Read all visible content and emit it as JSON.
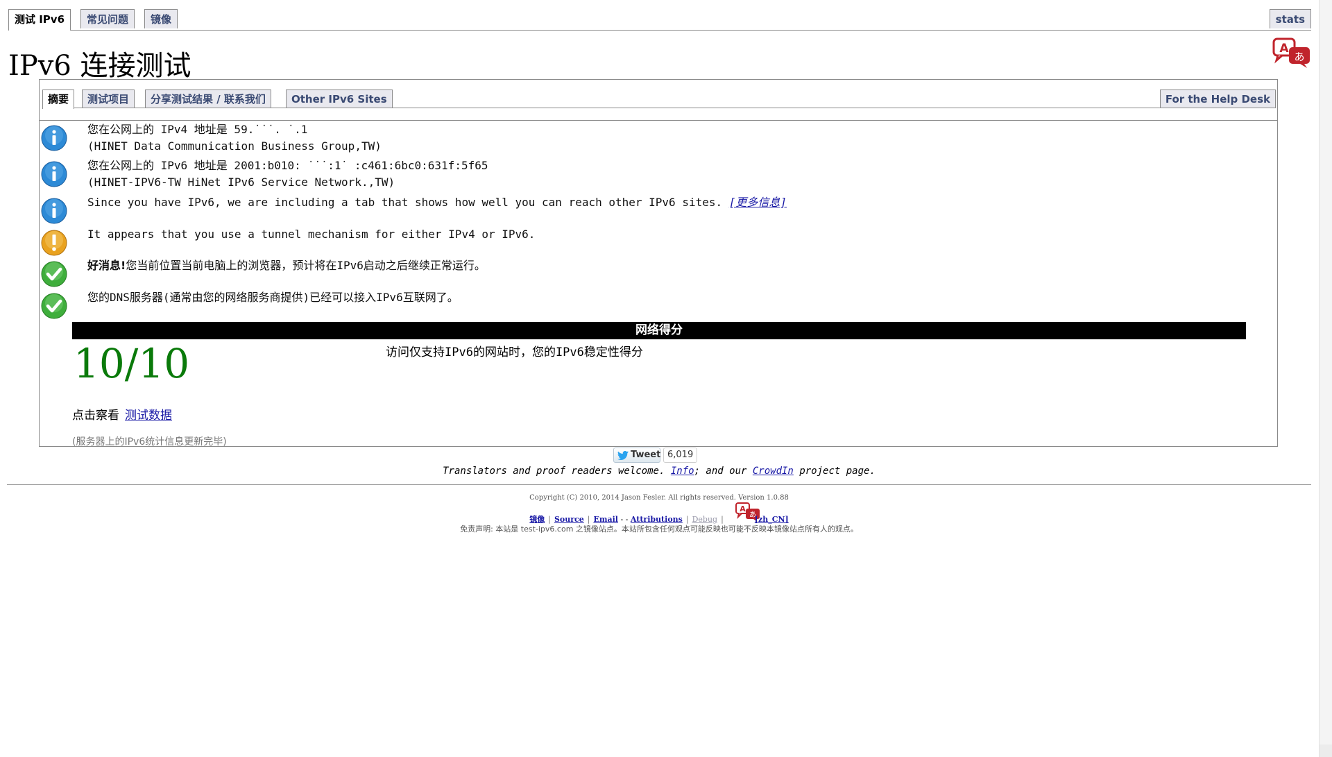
{
  "top_tabs": {
    "test_ipv6": "测试 IPv6",
    "faq": "常见问题",
    "mirrors": "镜像",
    "stats": "stats"
  },
  "page_title": "IPv6 连接测试",
  "sub_tabs": {
    "summary": "摘要",
    "test_items": "测试项目",
    "share": "分享测试结果 / 联系我们",
    "other_sites": "Other IPv6 Sites",
    "help_desk": "For the Help Desk"
  },
  "messages": [
    {
      "icon": "info-icon",
      "line1": "您在公网上的 IPv4 地址是 59.˙˙˙.  ˙.1",
      "line2": "(HINET Data Communication Business Group,TW)"
    },
    {
      "icon": "info-icon",
      "line1": "您在公网上的 IPv6 地址是 2001:b010: ˙˙˙:1˙   :c461:6bc0:631f:5f65",
      "line2": "(HINET-IPV6-TW HiNet IPv6 Service Network.,TW)"
    },
    {
      "icon": "info-icon",
      "line1": "Since you have IPv6, we are including a tab that shows how well you can reach other IPv6 sites.",
      "link": "[更多信息]"
    },
    {
      "icon": "warning-icon",
      "line1": "It appears that you use a tunnel mechanism for either IPv4 or IPv6."
    },
    {
      "icon": "check-icon",
      "bold": "好消息!",
      "line1": "您当前位置当前电脑上的浏览器，预计将在IPv6启动之后继续正常运行。"
    },
    {
      "icon": "check-icon",
      "line1": "您的DNS服务器(通常由您的网络服务商提供)已经可以接入IPv6互联网了。"
    }
  ],
  "score": {
    "header": "网络得分",
    "value": "10/10",
    "description": "访问仅支持IPv6的网站时，您的IPv6稳定性得分",
    "click_label": "点击察看",
    "click_link": "测试数据",
    "stats_note": "(服务器上的IPv6统计信息更新完毕)"
  },
  "tweet": {
    "label": "Tweet",
    "count": "6,019"
  },
  "translators": {
    "before": "Translators and proof readers welcome.",
    "info": "Info",
    "middle": "; and our",
    "crowdin": "CrowdIn",
    "after": "project page."
  },
  "footer": {
    "copyright": "Copyright (C) 2010, 2014 Jason Fesler. All rights reserved. Version 1.0.88",
    "links": {
      "mirrors": "镜像",
      "source": "Source",
      "email": "Email",
      "dash": "-  -",
      "attributions": "Attributions",
      "debug": "Debug",
      "locale": "[zh_CN]"
    },
    "disclaimer": "免责声明: 本站是 test-ipv6.com 之镜像站点。本站所包含任何观点可能反映也可能不反映本镜像站点所有人的观点。"
  },
  "colors": {
    "tab_text": "#3a4a73",
    "score_green": "#0a7a0a",
    "info_blue": "#2d8ad6",
    "warning_orange": "#e9a21f",
    "check_green": "#3fae3c",
    "link_blue": "#1a1aa6"
  }
}
